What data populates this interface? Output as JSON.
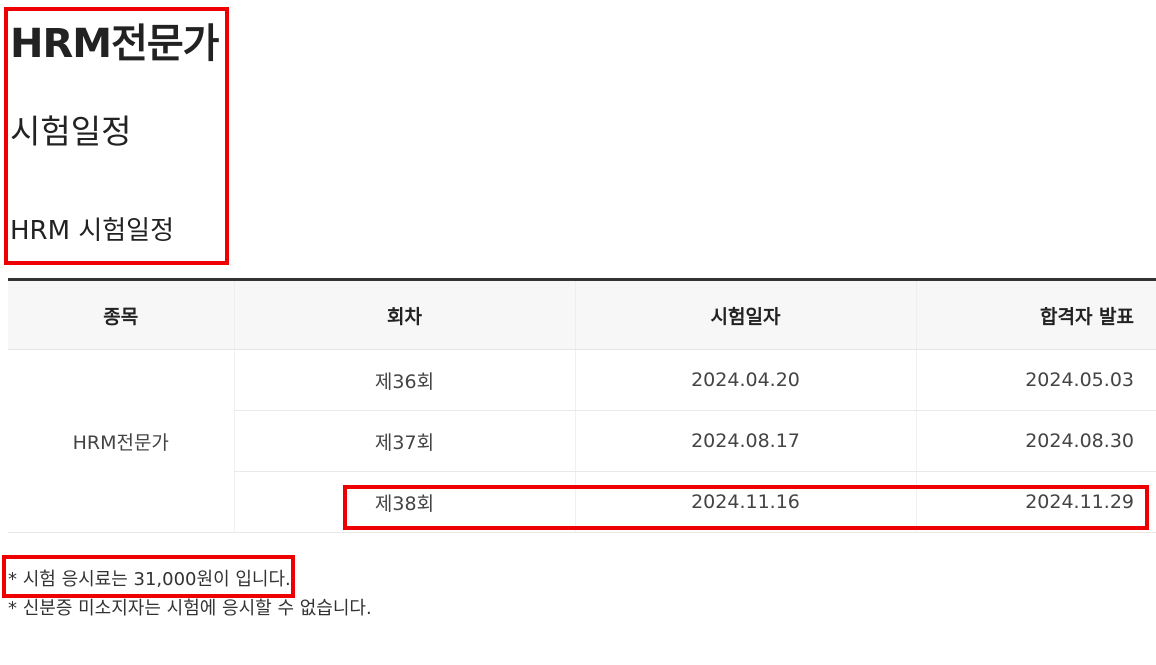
{
  "page": {
    "title": "HRM전문가",
    "subtitle": "시험일정",
    "section_title": "HRM 시험일정"
  },
  "table": {
    "headers": [
      "종목",
      "회차",
      "시험일자",
      "합격자 발표"
    ],
    "kind": "HRM전문가",
    "rows": [
      {
        "round": "제36회",
        "exam_date": "2024.04.20",
        "result_date": "2024.05.03"
      },
      {
        "round": "제37회",
        "exam_date": "2024.08.17",
        "result_date": "2024.08.30"
      },
      {
        "round": "제38회",
        "exam_date": "2024.11.16",
        "result_date": "2024.11.29"
      }
    ]
  },
  "notes": [
    "* 시험 응시료는 31,000원이 입니다.",
    "* 신분증 미소지자는 시험에 응시할 수 없습니다."
  ],
  "highlight_color": "#ee0000"
}
